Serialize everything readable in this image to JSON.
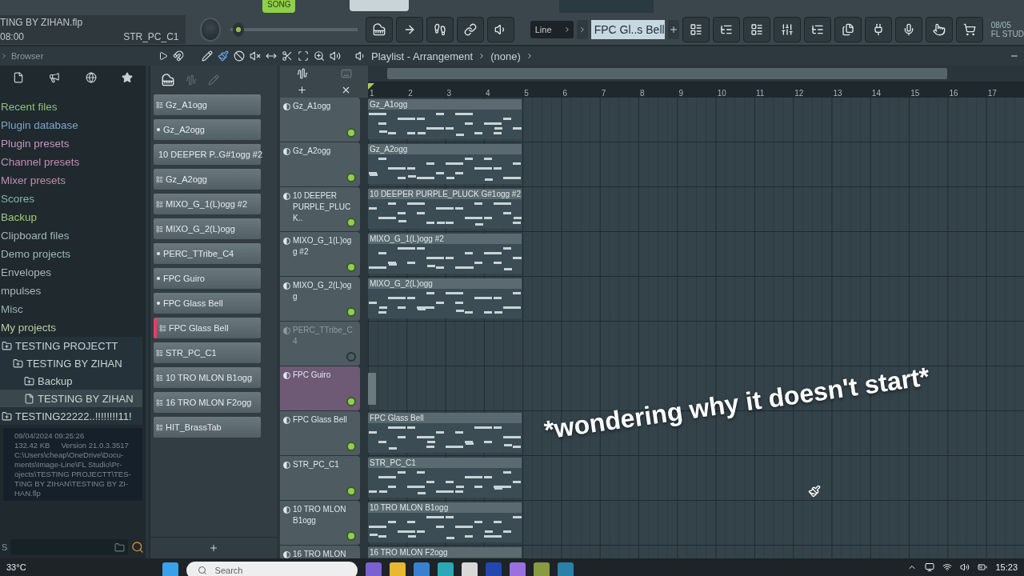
{
  "transport": {
    "mode": "SONG",
    "song_mode_on": true
  },
  "project": {
    "file": "TING BY ZIHAN.flp",
    "time": "08:00",
    "channel": "STR_PC_C1"
  },
  "master_slider": {
    "level": 0.02
  },
  "snap": {
    "value": "Line"
  },
  "tool_selector": {
    "value": "FPC Gl..s Bell"
  },
  "header_right": {
    "date": "08/05",
    "label": "FL STUD"
  },
  "browser": {
    "title": "Browser",
    "items": [
      {
        "label": "Recent files",
        "color": "#8fc07a"
      },
      {
        "label": "Plugin database",
        "color": "#7ea4c8"
      },
      {
        "label": "Plugin presets",
        "color": "#c894bc"
      },
      {
        "label": "Channel presets",
        "color": "#c48cb4"
      },
      {
        "label": "Mixer presets",
        "color": "#c08cb0"
      },
      {
        "label": "Scores",
        "color": "#84b8ac"
      },
      {
        "label": "Backup",
        "color": "#a4c878"
      },
      {
        "label": "Clipboard files",
        "color": "#a4b4bc"
      },
      {
        "label": "Demo projects",
        "color": "#9cb8b4"
      },
      {
        "label": "Envelopes",
        "color": "#a8b8b4"
      },
      {
        "label": "mpulses",
        "color": "#a8b8b8"
      },
      {
        "label": "Misc",
        "color": "#9cb0b4"
      },
      {
        "label": "My projects",
        "color": "#b8cca4"
      }
    ],
    "tree": [
      {
        "label": "TESTING PROJECTT",
        "kind": "folder",
        "selected": false,
        "children": [
          {
            "label": "TESTING BY ZIHAN",
            "kind": "folder",
            "selected": false,
            "children": [
              {
                "label": "Backup",
                "kind": "folder",
                "selected": false
              },
              {
                "label": "TESTING BY ZIHAN",
                "kind": "file",
                "selected": true
              }
            ]
          }
        ]
      },
      {
        "label": "TESTING22222..!!!!!!!!11!",
        "kind": "folder",
        "selected": false
      }
    ],
    "info": {
      "date": "09/04/2024 09:25:26",
      "size": "132.42 KB",
      "version": "Version 21.0.3.3517",
      "path_lines": [
        "C:\\Users\\cheap\\OneDrive\\Docu-",
        "ments\\Image-Line\\FL Studio\\Pr-",
        "ojects\\TESTING PROJECTT\\TES-",
        "TING BY ZIHAN\\TESTING BY ZI-",
        "HAN.flp"
      ]
    },
    "search_label": "S"
  },
  "channel_rack": {
    "channels": [
      {
        "name": "Gz_A1ogg",
        "kind": "pattern",
        "selected": false
      },
      {
        "name": "Gz_A2ogg",
        "kind": "sampler",
        "selected": false
      },
      {
        "name": "10 DEEPER P..G#1ogg #2",
        "kind": "pattern",
        "selected": false
      },
      {
        "name": "Gz_A2ogg",
        "kind": "pattern",
        "selected": false
      },
      {
        "name": "MIXO_G_1(L)ogg #2",
        "kind": "pattern",
        "selected": false
      },
      {
        "name": "MIXO_G_2(L)ogg",
        "kind": "pattern",
        "selected": false
      },
      {
        "name": "PERC_TTribe_C4",
        "kind": "sampler",
        "selected": false
      },
      {
        "name": "FPC Guiro",
        "kind": "sampler",
        "selected": false
      },
      {
        "name": "FPC Glass Bell",
        "kind": "sampler",
        "selected": false
      },
      {
        "name": "FPC Glass Bell",
        "kind": "pattern",
        "selected": true
      },
      {
        "name": "STR_PC_C1",
        "kind": "pattern",
        "selected": false
      },
      {
        "name": "10 TRO MLON B1ogg",
        "kind": "pattern",
        "selected": false
      },
      {
        "name": "16 TRO MLON F2ogg",
        "kind": "pattern",
        "selected": false
      },
      {
        "name": "HIT_BrassTab",
        "kind": "pattern",
        "selected": false
      }
    ]
  },
  "playlist": {
    "title": "Playlist - Arrangement",
    "pattern": "(none)",
    "bars": [
      "1",
      "2",
      "3",
      "4",
      "5",
      "6",
      "7",
      "8",
      "9",
      "10",
      "11",
      "12",
      "13",
      "14",
      "15",
      "16",
      "17"
    ],
    "tracks": [
      {
        "name": "Gz_A1ogg",
        "selected": false,
        "disabled": false,
        "clip": {
          "kind": "pattern",
          "label": "Gz_A1ogg"
        }
      },
      {
        "name": "Gz_A2ogg",
        "selected": false,
        "disabled": false,
        "clip": {
          "kind": "pattern",
          "label": "Gz_A2ogg"
        }
      },
      {
        "name": "10 DEEPER PURPLE_PLUCK..",
        "selected": false,
        "disabled": false,
        "clip": {
          "kind": "pattern",
          "label": "10 DEEPER PURPLE_PLUCK G#1ogg #2"
        }
      },
      {
        "name": "MIXO_G_1(L)ogg #2",
        "selected": false,
        "disabled": false,
        "clip": {
          "kind": "pattern",
          "label": "MIXO_G_1(L)ogg #2"
        }
      },
      {
        "name": "MIXO_G_2(L)ogg",
        "selected": false,
        "disabled": false,
        "clip": {
          "kind": "pattern",
          "label": "MIXO_G_2(L)ogg"
        }
      },
      {
        "name": "PERC_TTribe_C4",
        "selected": false,
        "disabled": true
      },
      {
        "name": "FPC Guiro",
        "selected": true,
        "disabled": false,
        "clip": {
          "kind": "stub"
        }
      },
      {
        "name": "FPC Glass Bell",
        "selected": false,
        "disabled": false,
        "clip": {
          "kind": "pattern",
          "label": "FPC Glass Bell"
        }
      },
      {
        "name": "STR_PC_C1",
        "selected": false,
        "disabled": false,
        "clip": {
          "kind": "pattern",
          "label": "STR_PC_C1"
        }
      },
      {
        "name": "10 TRO MLON B1ogg",
        "selected": false,
        "disabled": false,
        "clip": {
          "kind": "pattern",
          "label": "10 TRO MLON B1ogg"
        }
      },
      {
        "name": "16 TRO MLON",
        "selected": false,
        "disabled": false,
        "clip": {
          "kind": "pattern",
          "label": "16 TRO MLON F2ogg"
        }
      }
    ]
  },
  "caption": "*wondering why it doesn't start*",
  "taskbar": {
    "weather": "33°C",
    "search_placeholder": "Search",
    "clock": "15:23"
  }
}
